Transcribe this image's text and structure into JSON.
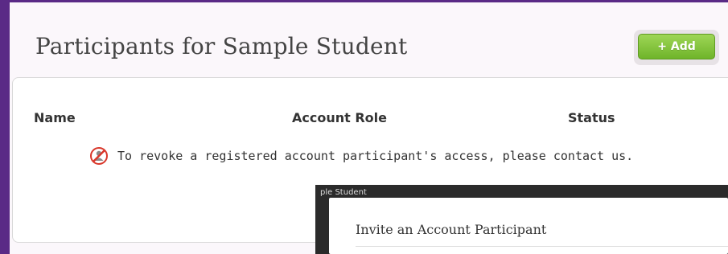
{
  "page": {
    "title": "Participants for Sample Student",
    "add_button": "+ Add"
  },
  "table": {
    "headers": [
      "Name",
      "Account Role",
      "Status"
    ]
  },
  "notice": {
    "text": "To revoke a registered account participant's access, please contact us.",
    "icon": "no-access-icon"
  },
  "modal": {
    "tab_text": "ple Student",
    "title": "Invite an Account Participant"
  },
  "colors": {
    "accent_purple": "#5a2a86",
    "add_button_green": "#6fb42a"
  }
}
